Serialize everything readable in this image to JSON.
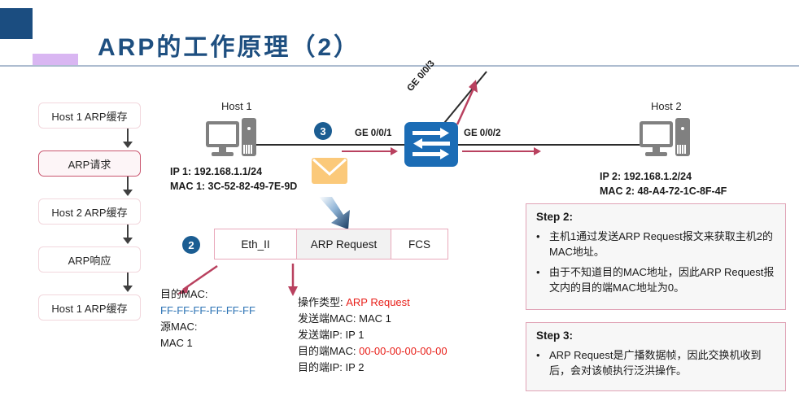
{
  "header": {
    "title": "ARP的工作原理（2）",
    "accent_dark": "#1b4d80",
    "accent_purple": "#d9b6f2",
    "rule_color": "#aebdd0"
  },
  "flowchart": {
    "items": [
      {
        "label": "Host 1 ARP缓存",
        "highlighted": false
      },
      {
        "label": "ARP请求",
        "highlighted": true
      },
      {
        "label": "Host 2 ARP缓存",
        "highlighted": false
      },
      {
        "label": "ARP响应",
        "highlighted": false
      },
      {
        "label": "Host 1 ARP缓存",
        "highlighted": false
      }
    ]
  },
  "topology": {
    "host1": {
      "name": "Host 1",
      "ip": "IP 1:  192.168.1.1/24",
      "mac": "MAC 1:  3C-52-82-49-7E-9D"
    },
    "host2": {
      "name": "Host 2",
      "ip": "IP 2:  192.168.1.2/24",
      "mac": "MAC 2:  48-A4-72-1C-8F-4F"
    },
    "ports": {
      "p1": "GE 0/0/1",
      "p2": "GE 0/0/2",
      "p3": "GE 0/0/3"
    },
    "step_markers": {
      "three": "3",
      "two": "2"
    },
    "arrow_color": "#b9415f",
    "switch_color": "#1b6cb5"
  },
  "frame": {
    "cells": [
      {
        "label": "Eth_II",
        "shaded": false
      },
      {
        "label": "ARP Request",
        "shaded": true
      },
      {
        "label": "FCS",
        "shaded": false
      }
    ]
  },
  "eth_detail": {
    "lines": [
      {
        "text": "目的MAC:",
        "color": "black"
      },
      {
        "text": "FF-FF-FF-FF-FF-FF",
        "color": "blue"
      },
      {
        "text": "源MAC:",
        "color": "black"
      },
      {
        "text": "MAC 1",
        "color": "black"
      }
    ]
  },
  "arp_detail": {
    "rows": [
      {
        "label": "操作类型:",
        "value": "ARP Request",
        "value_color": "red"
      },
      {
        "label": "发送端MAC:",
        "value": "MAC 1",
        "value_color": "black"
      },
      {
        "label": "发送端IP:",
        "value": "IP 1",
        "value_color": "black"
      },
      {
        "label": "目的端MAC:",
        "value": "00-00-00-00-00-00",
        "value_color": "red"
      },
      {
        "label": "目的端IP:",
        "value": "IP 2",
        "value_color": "black"
      }
    ]
  },
  "steps": [
    {
      "title": "Step 2:",
      "bullets": [
        "主机1通过发送ARP Request报文来获取主机2的MAC地址。",
        "由于不知道目的MAC地址，因此ARP Request报文内的目的端MAC地址为0。"
      ]
    },
    {
      "title": "Step 3:",
      "bullets": [
        "ARP Request是广播数据帧，因此交换机收到后，会对该帧执行泛洪操作。"
      ]
    }
  ]
}
